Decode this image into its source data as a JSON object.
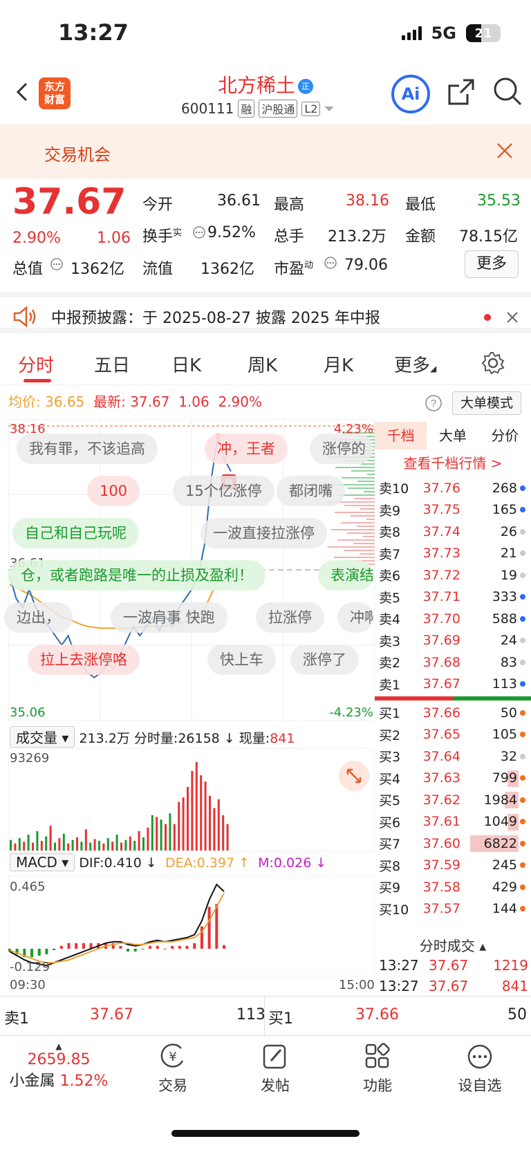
{
  "status": {
    "time": "13:27",
    "network": "5G",
    "battery": "21"
  },
  "header": {
    "logo_line1": "东方",
    "logo_line2": "财富",
    "stock_name": "北方稀土",
    "name_badge": "正",
    "stock_code": "600111",
    "tags": [
      "融",
      "沪股通",
      "L2"
    ],
    "ai_label": "Ai"
  },
  "banner": {
    "text": "交易机会"
  },
  "quote": {
    "price": "37.67",
    "change_pct": "2.90%",
    "change": "1.06",
    "open_label": "今开",
    "open": "36.61",
    "high_label": "最高",
    "high": "38.16",
    "low_label": "最低",
    "low": "35.53",
    "turnover_label": "换手",
    "turnover_sup": "实",
    "turnover": "9.52%",
    "total_hands_label": "总手",
    "total_hands": "213.2万",
    "amount_label": "金额",
    "amount": "78.15亿",
    "mcap_label": "总值",
    "mcap": "1362亿",
    "float_label": "流值",
    "float": "1362亿",
    "pe_label": "市盈",
    "pe_sup": "动",
    "pe": "79.06",
    "more": "更多"
  },
  "notice": {
    "text": "中报预披露：于 2025-08-27 披露 2025 年中报"
  },
  "tabs": [
    "分时",
    "五日",
    "日K",
    "周K",
    "月K",
    "更多"
  ],
  "chart_head": {
    "avg_label": "均价:",
    "avg": "36.65",
    "last_label": "最新:",
    "last": "37.67",
    "chg": "1.06",
    "pct": "2.90%",
    "mode": "大单模式"
  },
  "chart_data": {
    "type": "line",
    "y_max_label": "38.16",
    "y_mid_label": "36.61",
    "y_min_label": "35.06",
    "pct_max_label": "4.23%",
    "pct_min_label": "-4.23%",
    "x_start": "09:30",
    "x_end": "15:00",
    "ylim": [
      35.06,
      38.16
    ],
    "price": [
      36.55,
      36.3,
      36.2,
      36.4,
      36.2,
      36.1,
      36.0,
      35.9,
      35.8,
      35.9,
      35.7,
      35.6,
      35.5,
      35.45,
      35.5,
      35.6,
      35.55,
      35.7,
      35.85,
      36.0,
      35.9,
      36.0,
      36.1,
      35.95,
      36.1,
      36.0,
      36.2,
      36.3,
      36.4,
      36.55,
      36.9,
      37.6,
      38.05,
      37.8,
      37.67
    ],
    "avg_line": [
      36.45,
      36.42,
      36.38,
      36.35,
      36.3,
      36.25,
      36.2,
      36.15,
      36.1,
      36.08,
      36.05,
      36.02,
      36.0,
      35.99,
      35.98,
      35.98,
      35.98,
      35.98,
      35.98,
      35.99,
      35.99,
      36.0,
      36.0,
      36.0,
      36.01,
      36.02,
      36.03,
      36.05,
      36.08,
      36.12,
      36.2,
      36.35,
      36.5,
      36.6,
      36.65
    ],
    "volume_max_label": "93269",
    "volume_head": {
      "label": "成交量",
      "total": "213.2万",
      "tick_label": "分时量:",
      "tick": "26158",
      "tick_arrow": "↓",
      "now_label": "现量:",
      "now": "841"
    },
    "volume": [
      12,
      8,
      14,
      10,
      18,
      9,
      22,
      11,
      16,
      28,
      9,
      14,
      19,
      8,
      12,
      15,
      10,
      24,
      9,
      13,
      11,
      8,
      14,
      10,
      18,
      9,
      12,
      16,
      11,
      22,
      15,
      26,
      40,
      38,
      35,
      30,
      42,
      30,
      55,
      60,
      72,
      90,
      100,
      85,
      78,
      62,
      48,
      58,
      40,
      30
    ],
    "macd_head": {
      "label": "MACD",
      "dif": "DIF:0.410",
      "dea": "DEA:0.397",
      "m": "M:0.026"
    },
    "macd_max_label": "0.465",
    "macd_min_label": "-0.129",
    "dif": [
      -0.02,
      -0.05,
      -0.08,
      -0.1,
      -0.11,
      -0.12,
      -0.1,
      -0.08,
      -0.06,
      -0.04,
      -0.02,
      0.0,
      0.02,
      0.04,
      0.05,
      0.05,
      0.03,
      0.02,
      0.03,
      0.05,
      0.06,
      0.05,
      0.06,
      0.07,
      0.08,
      0.1,
      0.2,
      0.35,
      0.46,
      0.41
    ],
    "dea": [
      -0.01,
      -0.03,
      -0.05,
      -0.07,
      -0.09,
      -0.1,
      -0.1,
      -0.09,
      -0.08,
      -0.06,
      -0.04,
      -0.02,
      0.0,
      0.02,
      0.03,
      0.04,
      0.04,
      0.03,
      0.03,
      0.04,
      0.05,
      0.05,
      0.05,
      0.06,
      0.07,
      0.08,
      0.12,
      0.2,
      0.3,
      0.397
    ],
    "macd_hist": [
      -0.02,
      -0.04,
      -0.06,
      -0.06,
      -0.05,
      -0.04,
      -0.01,
      0.02,
      0.04,
      0.04,
      0.04,
      0.04,
      0.04,
      0.04,
      0.04,
      0.02,
      -0.02,
      -0.02,
      0.0,
      0.02,
      0.02,
      0.0,
      0.02,
      0.02,
      0.02,
      0.04,
      0.16,
      0.3,
      0.32,
      0.026
    ]
  },
  "bullets": [
    {
      "text": "我有罪，不该追高",
      "style": "grey"
    },
    {
      "text": "冲，王者",
      "style": "pink"
    },
    {
      "text": "涨停的",
      "style": "grey"
    },
    {
      "text": "100",
      "style": "pink"
    },
    {
      "text": "15个亿涨停",
      "style": "grey"
    },
    {
      "text": "都闭嘴",
      "style": "grey"
    },
    {
      "text": "自己和自己玩呢",
      "style": "green"
    },
    {
      "text": "一波直接拉涨停",
      "style": "grey"
    },
    {
      "text": "仓，或者跑路是唯一的止损及盈利！",
      "style": "green"
    },
    {
      "text": "表演结",
      "style": "green"
    },
    {
      "text": "边出，",
      "style": "grey"
    },
    {
      "text": "一波肩事 快跑",
      "style": "grey"
    },
    {
      "text": "拉涨停",
      "style": "grey"
    },
    {
      "text": "冲啊",
      "style": "grey"
    },
    {
      "text": "拉上去涨停咯",
      "style": "pink"
    },
    {
      "text": "快上车",
      "style": "grey"
    },
    {
      "text": "涨停了",
      "style": "grey"
    }
  ],
  "orderbook": {
    "tabs": [
      "千档",
      "大单",
      "分价"
    ],
    "link": "查看千档行情 >",
    "asks": [
      {
        "label": "卖10",
        "price": "37.76",
        "vol": "268",
        "dot": "#2d6cf0"
      },
      {
        "label": "卖9",
        "price": "37.75",
        "vol": "165",
        "dot": "#2d6cf0"
      },
      {
        "label": "卖8",
        "price": "37.74",
        "vol": "26",
        "dot": "#cccccc"
      },
      {
        "label": "卖7",
        "price": "37.73",
        "vol": "21",
        "dot": "#cccccc"
      },
      {
        "label": "卖6",
        "price": "37.72",
        "vol": "19",
        "dot": "#cccccc"
      },
      {
        "label": "卖5",
        "price": "37.71",
        "vol": "333",
        "dot": "#2d6cf0"
      },
      {
        "label": "卖4",
        "price": "37.70",
        "vol": "588",
        "dot": "#2d6cf0"
      },
      {
        "label": "卖3",
        "price": "37.69",
        "vol": "24",
        "dot": "#cccccc"
      },
      {
        "label": "卖2",
        "price": "37.68",
        "vol": "83",
        "dot": "#cccccc"
      },
      {
        "label": "卖1",
        "price": "37.67",
        "vol": "113",
        "dot": "#2d6cf0"
      }
    ],
    "bids": [
      {
        "label": "买1",
        "price": "37.66",
        "vol": "50",
        "dot": "#f07020"
      },
      {
        "label": "买2",
        "price": "37.65",
        "vol": "105",
        "dot": "#f07020"
      },
      {
        "label": "买3",
        "price": "37.64",
        "vol": "32",
        "dot": "#cccccc"
      },
      {
        "label": "买4",
        "price": "37.63",
        "vol": "799",
        "dot": "#f07020"
      },
      {
        "label": "买5",
        "price": "37.62",
        "vol": "1984",
        "dot": "#f07020"
      },
      {
        "label": "买6",
        "price": "37.61",
        "vol": "1049",
        "dot": "#f07020"
      },
      {
        "label": "买7",
        "price": "37.60",
        "vol": "6822",
        "dot": "#f07020"
      },
      {
        "label": "买8",
        "price": "37.59",
        "vol": "245",
        "dot": "#f07020"
      },
      {
        "label": "买9",
        "price": "37.58",
        "vol": "429",
        "dot": "#f07020"
      },
      {
        "label": "买10",
        "price": "37.57",
        "vol": "144",
        "dot": "#f07020"
      }
    ],
    "trades_title": "分时成交",
    "trades": [
      {
        "time": "13:27",
        "price": "37.67",
        "vol": "1219"
      },
      {
        "time": "13:27",
        "price": "37.67",
        "vol": "841"
      }
    ]
  },
  "bidask": {
    "ask_label": "卖1",
    "ask_price": "37.67",
    "ask_vol": "113",
    "bid_label": "买1",
    "bid_price": "37.66",
    "bid_vol": "50"
  },
  "nav": {
    "index_value": "2659.85",
    "index_name": "小金属",
    "index_pct": "1.52%",
    "items": [
      "交易",
      "发帖",
      "功能",
      "设自选"
    ]
  }
}
